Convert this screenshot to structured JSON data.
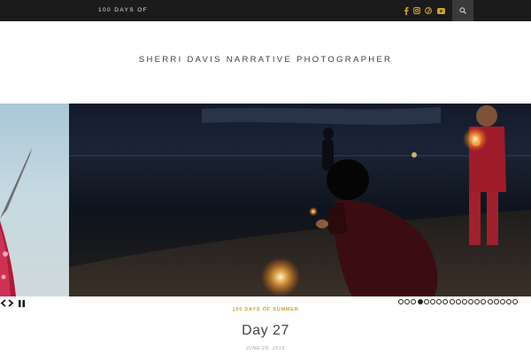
{
  "topbar": {
    "menu_label": "100 DAYS OF",
    "social_icons": [
      "facebook-icon",
      "instagram-icon",
      "pinterest-icon",
      "youtube-icon"
    ],
    "accent_color": "#c9a227",
    "search_icon": "search-icon"
  },
  "header": {
    "site_title": "SHERRI DAVIS NARRATIVE PHOTOGRAPHER"
  },
  "slider": {
    "prev_icon": "chevron-left-icon",
    "next_icon": "chevron-right-icon",
    "pause_icon": "pause-icon",
    "total_slides": 19,
    "active_slide": 4
  },
  "post": {
    "category": "100 DAYS OF SUMMER",
    "title": "Day 27",
    "date": "JUNE 28, 2015"
  }
}
